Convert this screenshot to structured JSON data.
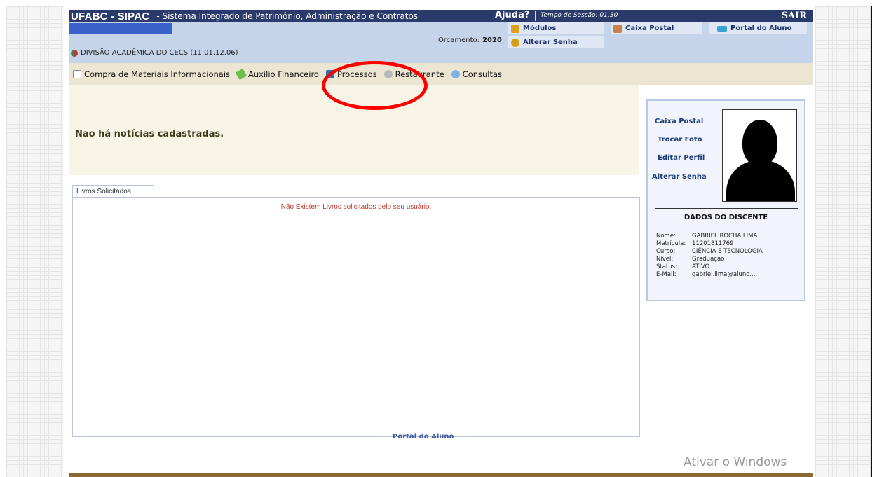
{
  "topbar": {
    "brand": "UFABC - SIPAC",
    "system_name": "- Sistema Integrado de Patrimônio, Administração e Contratos",
    "help": "Ajuda?",
    "session": "Tempo de Sessão: 01:30",
    "exit": "SAIR"
  },
  "info": {
    "department": "DIVISÃO ACADÊMICA DO CECS (11.01.12.06)",
    "budget_label": "Orçamento:",
    "budget_year": "2020",
    "modules": "Módulos",
    "mailbox": "Caixa Postal",
    "student_portal": "Portal do Aluno",
    "change_password": "Alterar Senha"
  },
  "menu": {
    "items": [
      {
        "label": "Compra de Materiais Informacionais",
        "icon": "document-icon"
      },
      {
        "label": "Auxílio Financeiro",
        "icon": "money-icon"
      },
      {
        "label": "Processos",
        "icon": "book-icon"
      },
      {
        "label": "Restaurante",
        "icon": "restaurant-icon"
      },
      {
        "label": "Consultas",
        "icon": "magnifier-icon"
      }
    ]
  },
  "news": {
    "message": "Não há notícias cadastradas."
  },
  "tabs": {
    "books_tab": "Livros Solicitados",
    "books_message": "Não Existem Livros solicitados pelo seu usuário."
  },
  "footer": {
    "portal_link": "Portal do Aluno"
  },
  "profile": {
    "links": [
      "Caixa Postal",
      "Trocar Foto",
      "Editar Perfil",
      "Alterar Senha"
    ],
    "heading": "DADOS DO DISCENTE",
    "fields": [
      {
        "label": "Nome:",
        "value": "GABRIEL ROCHA LIMA"
      },
      {
        "label": "Matrícula:",
        "value": "11201811769"
      },
      {
        "label": "Curso:",
        "value": "CIÊNCIA E TECNOLOGIA"
      },
      {
        "label": "Nível:",
        "value": "Graduação"
      },
      {
        "label": "Status:",
        "value": "ATIVO"
      },
      {
        "label": "E-Mail:",
        "value": "gabriel.lima@aluno...."
      }
    ]
  },
  "watermark": "Ativar o Windows",
  "colors": {
    "header_navy": "#2a3a6b",
    "info_blue": "#c6d4ea",
    "menu_beige": "#ece5d2",
    "annotation_red": "#ff0000",
    "error_red": "#c0392b"
  }
}
